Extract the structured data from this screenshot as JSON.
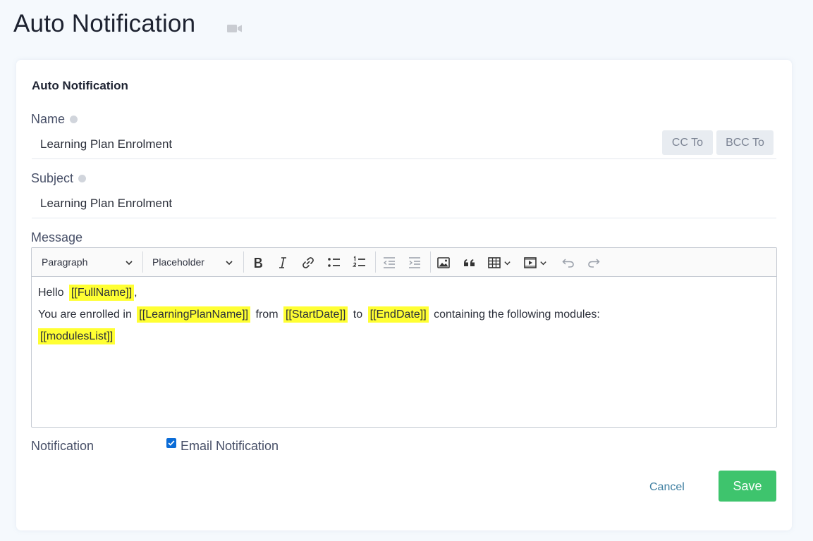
{
  "page": {
    "title": "Auto Notification",
    "title_icon": "video-camera-icon"
  },
  "form": {
    "section_title": "Auto Notification",
    "name": {
      "label": "Name",
      "value": "Learning Plan Enrolment"
    },
    "subject": {
      "label": "Subject",
      "value": "Learning Plan Enrolment"
    },
    "cc_label": "CC To",
    "bcc_label": "BCC To",
    "message_label": "Message"
  },
  "toolbar": {
    "format_select": "Paragraph",
    "placeholder_select": "Placeholder",
    "buttons": [
      "bold-icon",
      "italic-icon",
      "link-icon",
      "bulleted-list-icon",
      "numbered-list-icon",
      "outdent-icon",
      "indent-icon",
      "image-icon",
      "blockquote-icon",
      "table-icon",
      "media-icon",
      "undo-icon",
      "redo-icon"
    ]
  },
  "message": {
    "greeting": "Hello",
    "fullname": "[[FullName]]",
    "greeting_end": ",",
    "enrolled_text": "You are enrolled in",
    "plan": "[[LearningPlanName]]",
    "from_text": "from",
    "start": "[[StartDate]]",
    "to_text": "to",
    "end": "[[EndDate]]",
    "following_text": "containing the following modules:",
    "modules": "[[modulesList]]"
  },
  "notification": {
    "label": "Notification",
    "email_label": "Email Notification",
    "email_checked": true
  },
  "actions": {
    "cancel": "Cancel",
    "save": "Save"
  },
  "colors": {
    "save": "#3ec46d",
    "placeholder_highlight": "#ffff33",
    "checkbox": "#0b6cd7",
    "cancel": "#3f7fa1"
  }
}
